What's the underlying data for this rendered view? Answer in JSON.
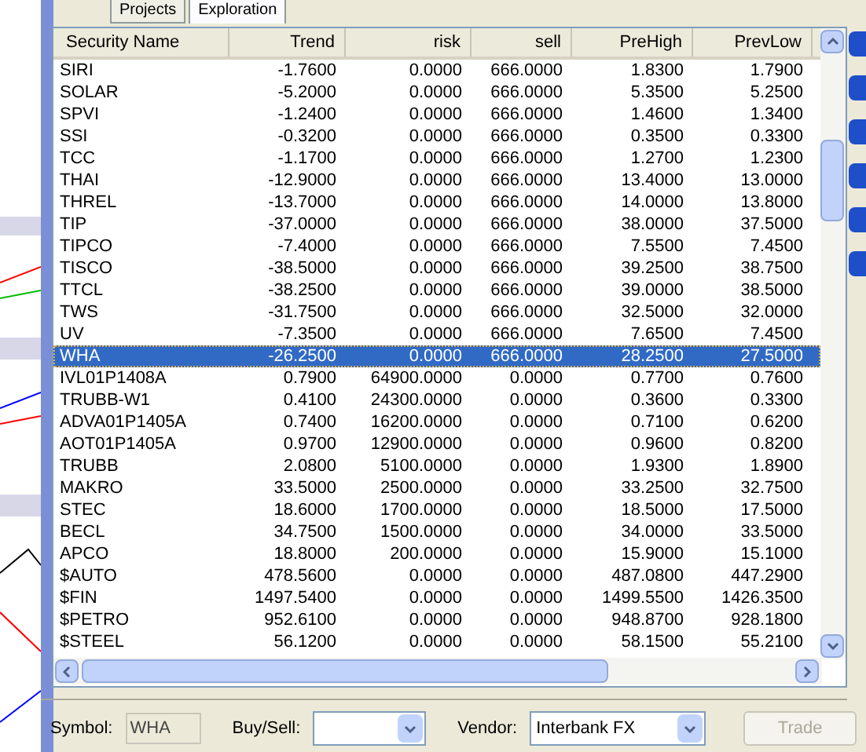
{
  "tabs": [
    {
      "label": "Projects",
      "selected": false
    },
    {
      "label": "Exploration",
      "selected": true
    }
  ],
  "table": {
    "columns": [
      "Security Name",
      "Trend",
      "risk",
      "sell",
      "PreHigh",
      "PrevLow"
    ],
    "rows": [
      {
        "cells": [
          "SIRI",
          "-1.7600",
          "0.0000",
          "666.0000",
          "1.8300",
          "1.7900"
        ],
        "selected": false
      },
      {
        "cells": [
          "SOLAR",
          "-5.2000",
          "0.0000",
          "666.0000",
          "5.3500",
          "5.2500"
        ],
        "selected": false
      },
      {
        "cells": [
          "SPVI",
          "-1.2400",
          "0.0000",
          "666.0000",
          "1.4600",
          "1.3400"
        ],
        "selected": false
      },
      {
        "cells": [
          "SSI",
          "-0.3200",
          "0.0000",
          "666.0000",
          "0.3500",
          "0.3300"
        ],
        "selected": false
      },
      {
        "cells": [
          "TCC",
          "-1.1700",
          "0.0000",
          "666.0000",
          "1.2700",
          "1.2300"
        ],
        "selected": false
      },
      {
        "cells": [
          "THAI",
          "-12.9000",
          "0.0000",
          "666.0000",
          "13.4000",
          "13.0000"
        ],
        "selected": false
      },
      {
        "cells": [
          "THREL",
          "-13.7000",
          "0.0000",
          "666.0000",
          "14.0000",
          "13.8000"
        ],
        "selected": false
      },
      {
        "cells": [
          "TIP",
          "-37.0000",
          "0.0000",
          "666.0000",
          "38.0000",
          "37.5000"
        ],
        "selected": false
      },
      {
        "cells": [
          "TIPCO",
          "-7.4000",
          "0.0000",
          "666.0000",
          "7.5500",
          "7.4500"
        ],
        "selected": false
      },
      {
        "cells": [
          "TISCO",
          "-38.5000",
          "0.0000",
          "666.0000",
          "39.2500",
          "38.7500"
        ],
        "selected": false
      },
      {
        "cells": [
          "TTCL",
          "-38.2500",
          "0.0000",
          "666.0000",
          "39.0000",
          "38.5000"
        ],
        "selected": false
      },
      {
        "cells": [
          "TWS",
          "-31.7500",
          "0.0000",
          "666.0000",
          "32.5000",
          "32.0000"
        ],
        "selected": false
      },
      {
        "cells": [
          "UV",
          "-7.3500",
          "0.0000",
          "666.0000",
          "7.6500",
          "7.4500"
        ],
        "selected": false
      },
      {
        "cells": [
          "WHA",
          "-26.2500",
          "0.0000",
          "666.0000",
          "28.2500",
          "27.5000"
        ],
        "selected": true
      },
      {
        "cells": [
          "IVL01P1408A",
          "0.7900",
          "64900.0000",
          "0.0000",
          "0.7700",
          "0.7600"
        ],
        "selected": false
      },
      {
        "cells": [
          "TRUBB-W1",
          "0.4100",
          "24300.0000",
          "0.0000",
          "0.3600",
          "0.3300"
        ],
        "selected": false
      },
      {
        "cells": [
          "ADVA01P1405A",
          "0.7400",
          "16200.0000",
          "0.0000",
          "0.7100",
          "0.6200"
        ],
        "selected": false
      },
      {
        "cells": [
          "AOT01P1405A",
          "0.9700",
          "12900.0000",
          "0.0000",
          "0.9600",
          "0.8200"
        ],
        "selected": false
      },
      {
        "cells": [
          "TRUBB",
          "2.0800",
          "5100.0000",
          "0.0000",
          "1.9300",
          "1.8900"
        ],
        "selected": false
      },
      {
        "cells": [
          "MAKRO",
          "33.5000",
          "2500.0000",
          "0.0000",
          "33.2500",
          "32.7500"
        ],
        "selected": false
      },
      {
        "cells": [
          "STEC",
          "18.6000",
          "1700.0000",
          "0.0000",
          "18.5000",
          "17.5000"
        ],
        "selected": false
      },
      {
        "cells": [
          "BECL",
          "34.7500",
          "1500.0000",
          "0.0000",
          "34.0000",
          "33.5000"
        ],
        "selected": false
      },
      {
        "cells": [
          "APCO",
          "18.8000",
          "200.0000",
          "0.0000",
          "15.9000",
          "15.1000"
        ],
        "selected": false
      },
      {
        "cells": [
          "$AUTO",
          "478.5600",
          "0.0000",
          "0.0000",
          "487.0800",
          "447.2900"
        ],
        "selected": false
      },
      {
        "cells": [
          "$FIN",
          "1497.5400",
          "0.0000",
          "0.0000",
          "1499.5500",
          "1426.3500"
        ],
        "selected": false
      },
      {
        "cells": [
          "$PETRO",
          "952.6100",
          "0.0000",
          "0.0000",
          "948.8700",
          "928.1800"
        ],
        "selected": false
      },
      {
        "cells": [
          "$STEEL",
          "56.1200",
          "0.0000",
          "0.0000",
          "58.1500",
          "55.2100"
        ],
        "selected": false
      }
    ]
  },
  "order_bar": {
    "symbol_label": "Symbol:",
    "symbol_value": "WHA",
    "side_label": "Buy/Sell:",
    "vendor_label": "Vendor:",
    "vendor_value": "Interbank FX",
    "trade_button": {
      "label": "Trade",
      "disabled": true
    }
  }
}
